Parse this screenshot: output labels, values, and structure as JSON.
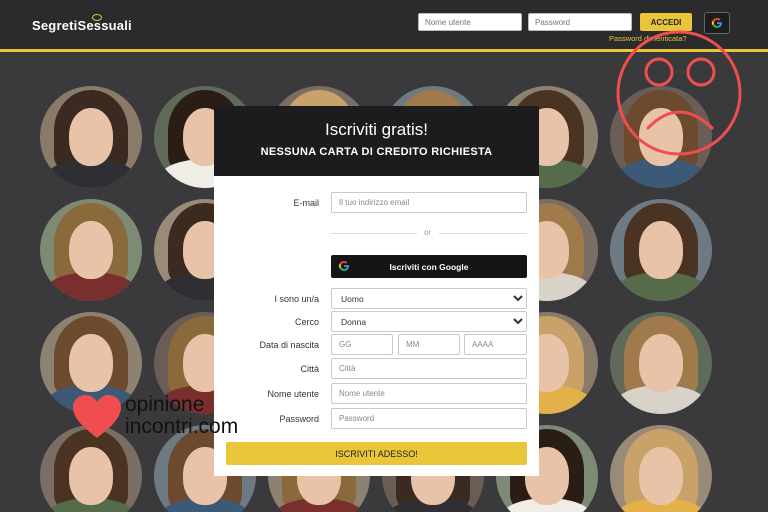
{
  "header": {
    "logo": "SegretiSessuali",
    "username_placeholder": "Nome utente",
    "password_placeholder": "Password",
    "login_label": "ACCEDI",
    "google_icon": "google-g-icon",
    "forgot_password": "Password dimenticata?"
  },
  "signup": {
    "title": "Iscriviti gratis!",
    "subtitle": "NESSUNA CARTA DI CREDITO RICHIESTA",
    "email_label": "E-mail",
    "email_placeholder": "Il tuo indirizzo email",
    "or_text": "or",
    "google_button": "Iscriviti con Google",
    "iam_label": "I sono un/a",
    "iam_value": "Uomo",
    "seeking_label": "Cerco",
    "seeking_value": "Donna",
    "dob_label": "Data di nascita",
    "dob_day_placeholder": "GG",
    "dob_month_placeholder": "MM",
    "dob_year_placeholder": "AAAA",
    "city_label": "Città",
    "city_placeholder": "Città",
    "username_label": "Nome utente",
    "username_placeholder": "Nome utente",
    "password_label": "Password",
    "password_placeholder": "Password",
    "submit_label": "ISCRIVITI ADESSO!"
  },
  "overlays": {
    "sad_face_icon": "sad-face-icon",
    "brand_line1": "opinione",
    "brand_line2": "incontri.com",
    "heart_icon": "heart-icon"
  },
  "colors": {
    "accent": "#e9c53a",
    "background": "#3a3a3c",
    "sad_face": "#f04e4e",
    "heart": "#f04e4e"
  }
}
